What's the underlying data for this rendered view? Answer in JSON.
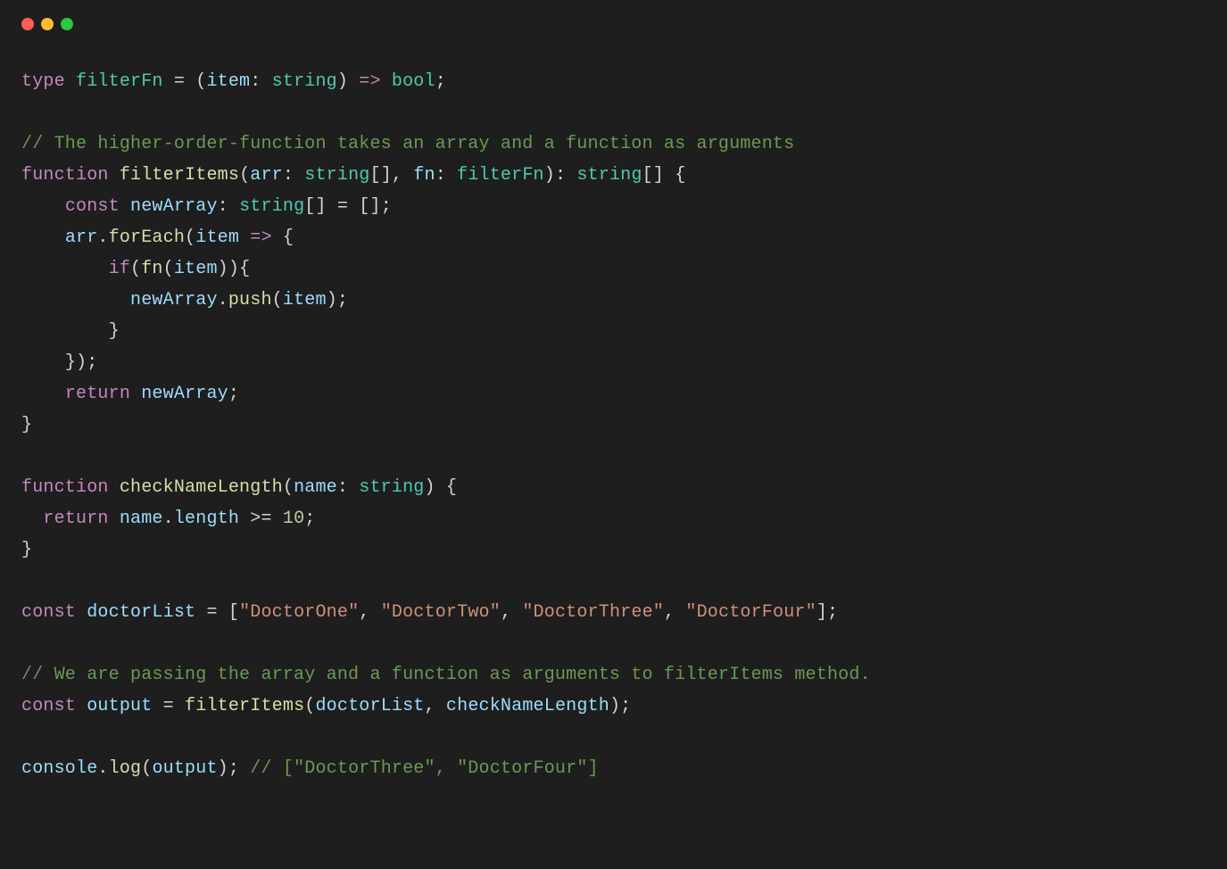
{
  "window": {
    "titlebar": {
      "buttons": [
        "close",
        "minimize",
        "zoom"
      ]
    }
  },
  "code": {
    "l1": {
      "kw_type": "type",
      "id_filterFn": "filterFn",
      "eq": " = ",
      "lp": "(",
      "id_item": "item",
      "colon": ": ",
      "ty_string": "string",
      "rp": ")",
      "arrow": " => ",
      "ty_bool": "bool",
      "semi": ";"
    },
    "l2": "",
    "l3": {
      "cm": "// The higher-order-function takes an array and a function as arguments"
    },
    "l4": {
      "kw_function": "function",
      "sp": " ",
      "fn_filterItems": "filterItems",
      "lp": "(",
      "id_arr": "arr",
      "c1": ": ",
      "ty_stringArr": "string",
      "brk1": "[]",
      "comma": ", ",
      "id_fn": "fn",
      "c2": ": ",
      "ty_filterFn": "filterFn",
      "rp": ")",
      "c3": ": ",
      "ty_stringArr2": "string",
      "brk2": "[]",
      "sp2": " ",
      "lb": "{"
    },
    "l5": {
      "indent": "    ",
      "kw_const": "const",
      "sp": " ",
      "id_newArray": "newArray",
      "c1": ": ",
      "ty_string": "string",
      "brk": "[]",
      "eq": " = ",
      "arrlit": "[]",
      "semi": ";"
    },
    "l6": {
      "indent": "    ",
      "id_arr": "arr",
      "dot": ".",
      "fn_forEach": "forEach",
      "lp": "(",
      "id_item": "item",
      "arrow": " => ",
      "lb": "{"
    },
    "l7": {
      "indent": "        ",
      "kw_if": "if",
      "lp": "(",
      "fn_fn": "fn",
      "lp2": "(",
      "id_item": "item",
      "rp2": ")",
      "rp": ")",
      "lb": "{"
    },
    "l8": {
      "indent": "          ",
      "id_newArray": "newArray",
      "dot": ".",
      "fn_push": "push",
      "lp": "(",
      "id_item": "item",
      "rp": ")",
      "semi": ";"
    },
    "l9": {
      "indent": "        ",
      "rb": "}"
    },
    "l10": {
      "indent": "    ",
      "rb": "}",
      "rp": ")",
      "semi": ";"
    },
    "l11": {
      "indent": "    ",
      "kw_return": "return",
      "sp": " ",
      "id_newArray": "newArray",
      "semi": ";"
    },
    "l12": {
      "rb": "}"
    },
    "l13": "",
    "l14": {
      "kw_function": "function",
      "sp": " ",
      "fn_checkNameLength": "checkNameLength",
      "lp": "(",
      "id_name": "name",
      "c1": ": ",
      "ty_string": "string",
      "rp": ")",
      "sp2": " ",
      "lb": "{"
    },
    "l15": {
      "indent": "  ",
      "kw_return": "return",
      "sp": " ",
      "id_name": "name",
      "dot": ".",
      "id_length": "length",
      "op": " >= ",
      "nm_10": "10",
      "semi": ";"
    },
    "l16": {
      "rb": "}"
    },
    "l17": "",
    "l18": {
      "kw_const": "const",
      "sp": " ",
      "id_doctorList": "doctorList",
      "eq": " = ",
      "lb": "[",
      "s1": "\"DoctorOne\"",
      "c1": ", ",
      "s2": "\"DoctorTwo\"",
      "c2": ", ",
      "s3": "\"DoctorThree\"",
      "c3": ", ",
      "s4": "\"DoctorFour\"",
      "rb": "]",
      "semi": ";"
    },
    "l19": "",
    "l20": {
      "cm": "// We are passing the array and a function as arguments to filterItems method."
    },
    "l21": {
      "kw_const": "const",
      "sp": " ",
      "id_output": "output",
      "eq": " = ",
      "fn_filterItems": "filterItems",
      "lp": "(",
      "id_doctorList": "doctorList",
      "comma": ", ",
      "id_checkNameLength": "checkNameLength",
      "rp": ")",
      "semi": ";"
    },
    "l22": "",
    "l23": {
      "id_console": "console",
      "dot": ".",
      "fn_log": "log",
      "lp": "(",
      "id_output": "output",
      "rp": ")",
      "semi": ";",
      "sp": " ",
      "cm": "// [\"DoctorThree\", \"DoctorFour\"]"
    }
  }
}
